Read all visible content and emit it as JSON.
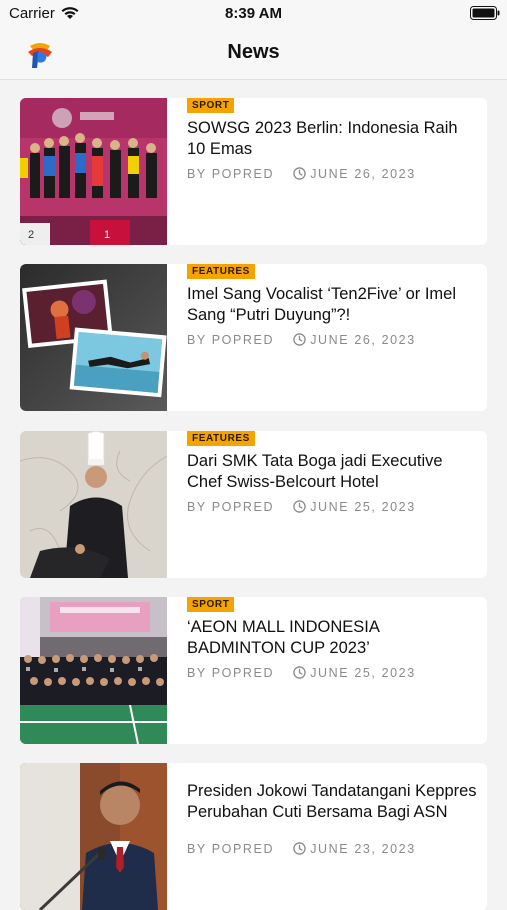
{
  "status": {
    "carrier": "Carrier",
    "time": "8:39 AM"
  },
  "nav": {
    "title": "News"
  },
  "articles": [
    {
      "category": "SPORT",
      "title": "SOWSG 2023 Berlin: Indonesia Raih 10 Emas",
      "author": "BY POPRED",
      "date": "JUNE 26, 2023"
    },
    {
      "category": "FEATURES",
      "title": "Imel Sang Vocalist ‘Ten2Five’ or Imel Sang “Putri Duyung”?!",
      "author": "BY POPRED",
      "date": "JUNE 26, 2023"
    },
    {
      "category": "FEATURES",
      "title": "Dari SMK Tata Boga jadi Executive Chef Swiss-Belcourt Hotel",
      "author": "BY POPRED",
      "date": "JUNE 25, 2023"
    },
    {
      "category": "SPORT",
      "title": "‘AEON MALL INDONESIA BADMINTON CUP 2023’",
      "author": "BY POPRED",
      "date": "JUNE 25, 2023"
    },
    {
      "category": "",
      "title": "Presiden Jokowi Tandatangani Keppres Perubahan Cuti Bersama Bagi ASN",
      "author": "BY POPRED",
      "date": "JUNE 23, 2023"
    }
  ],
  "colors": {
    "badge": "#f5a300",
    "background": "#f3f3f3",
    "card": "#ffffff",
    "meta": "#8a8a8a"
  }
}
